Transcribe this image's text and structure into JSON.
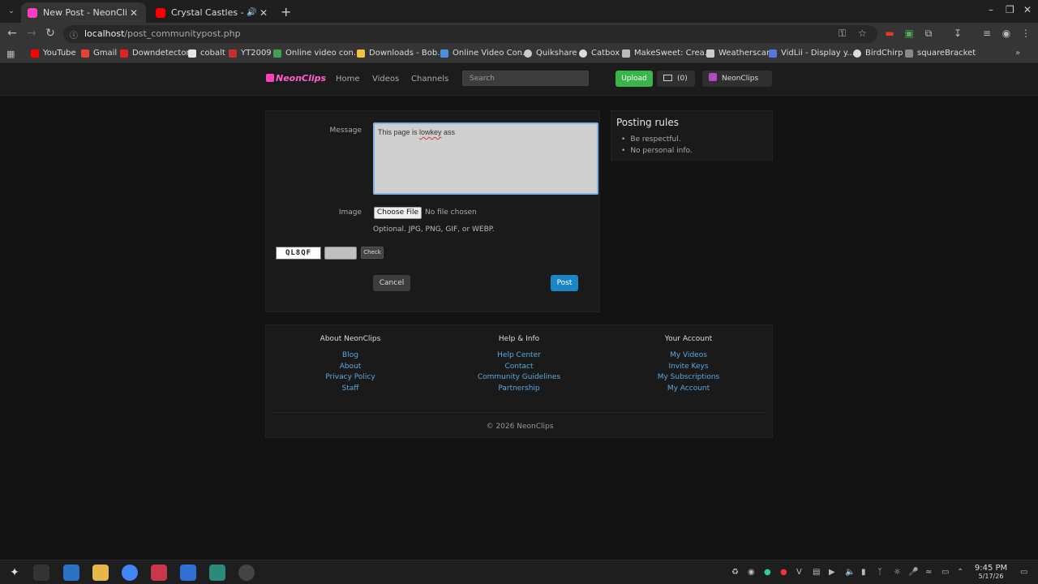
{
  "browser": {
    "tabs": [
      {
        "title": "New Post - NeonClips",
        "active": true
      },
      {
        "title": "Crystal Castles - Magic Sp",
        "active": false
      }
    ],
    "url_host": "localhost",
    "url_path": "/post_communitypost.php",
    "bookmarks": [
      {
        "label": "YouTube",
        "color": "#ff0000"
      },
      {
        "label": "Gmail",
        "color": "#ea4335"
      },
      {
        "label": "Downdetector",
        "color": "#e3202a"
      },
      {
        "label": "cobalt",
        "color": "#e6e6e6"
      },
      {
        "label": "YT2009",
        "color": "#c4302b"
      },
      {
        "label": "Online video con...",
        "color": "#3fa34d"
      },
      {
        "label": "Downloads - Bob...",
        "color": "#f5c242"
      },
      {
        "label": "Online Video Con...",
        "color": "#4a90e2"
      },
      {
        "label": "Quikshare",
        "color": "#cccccc"
      },
      {
        "label": "Catbox",
        "color": "#dddddd"
      },
      {
        "label": "MakeSweet: Crea...",
        "color": "#bbbbbb"
      },
      {
        "label": "Weatherscan",
        "color": "#cccccc"
      },
      {
        "label": "VidLii - Display y...",
        "color": "#5577dd"
      },
      {
        "label": "BirdChirp",
        "color": "#dddddd"
      },
      {
        "label": "squareBracket",
        "color": "#888888"
      }
    ]
  },
  "site": {
    "logo": "NeonClips",
    "nav": [
      "Home",
      "Videos",
      "Channels"
    ],
    "search_placeholder": "Search",
    "upload_label": "Upload",
    "inbox_count": "(0)",
    "account_name": "NeonClips",
    "accent": "#39b54a"
  },
  "form": {
    "message_label": "Message",
    "message_text_pre": "This page is ",
    "message_text_typo": "lowkey",
    "message_text_post": " ass",
    "image_label": "Image",
    "choose_file_label": "Choose File",
    "no_file_label": "No file chosen",
    "image_hint": "Optional. JPG, PNG, GIF, or WEBP.",
    "captcha_text": "QL8QF",
    "check_label": "Check",
    "cancel_label": "Cancel",
    "post_label": "Post"
  },
  "rules": {
    "title": "Posting rules",
    "items": [
      "Be respectful.",
      "No personal info."
    ]
  },
  "footer": {
    "columns": [
      {
        "heading": "About NeonClips",
        "links": [
          "Blog",
          "About",
          "Privacy Policy",
          "Staff"
        ]
      },
      {
        "heading": "Help & Info",
        "links": [
          "Help Center",
          "Contact",
          "Community Guidelines",
          "Partnership"
        ]
      },
      {
        "heading": "Your Account",
        "links": [
          "My Videos",
          "Invite Keys",
          "My Subscriptions",
          "My Account"
        ]
      }
    ],
    "copyright": "© 2026 NeonClips"
  },
  "taskbar": {
    "time": "9:45 PM",
    "date": "5/17/26"
  }
}
